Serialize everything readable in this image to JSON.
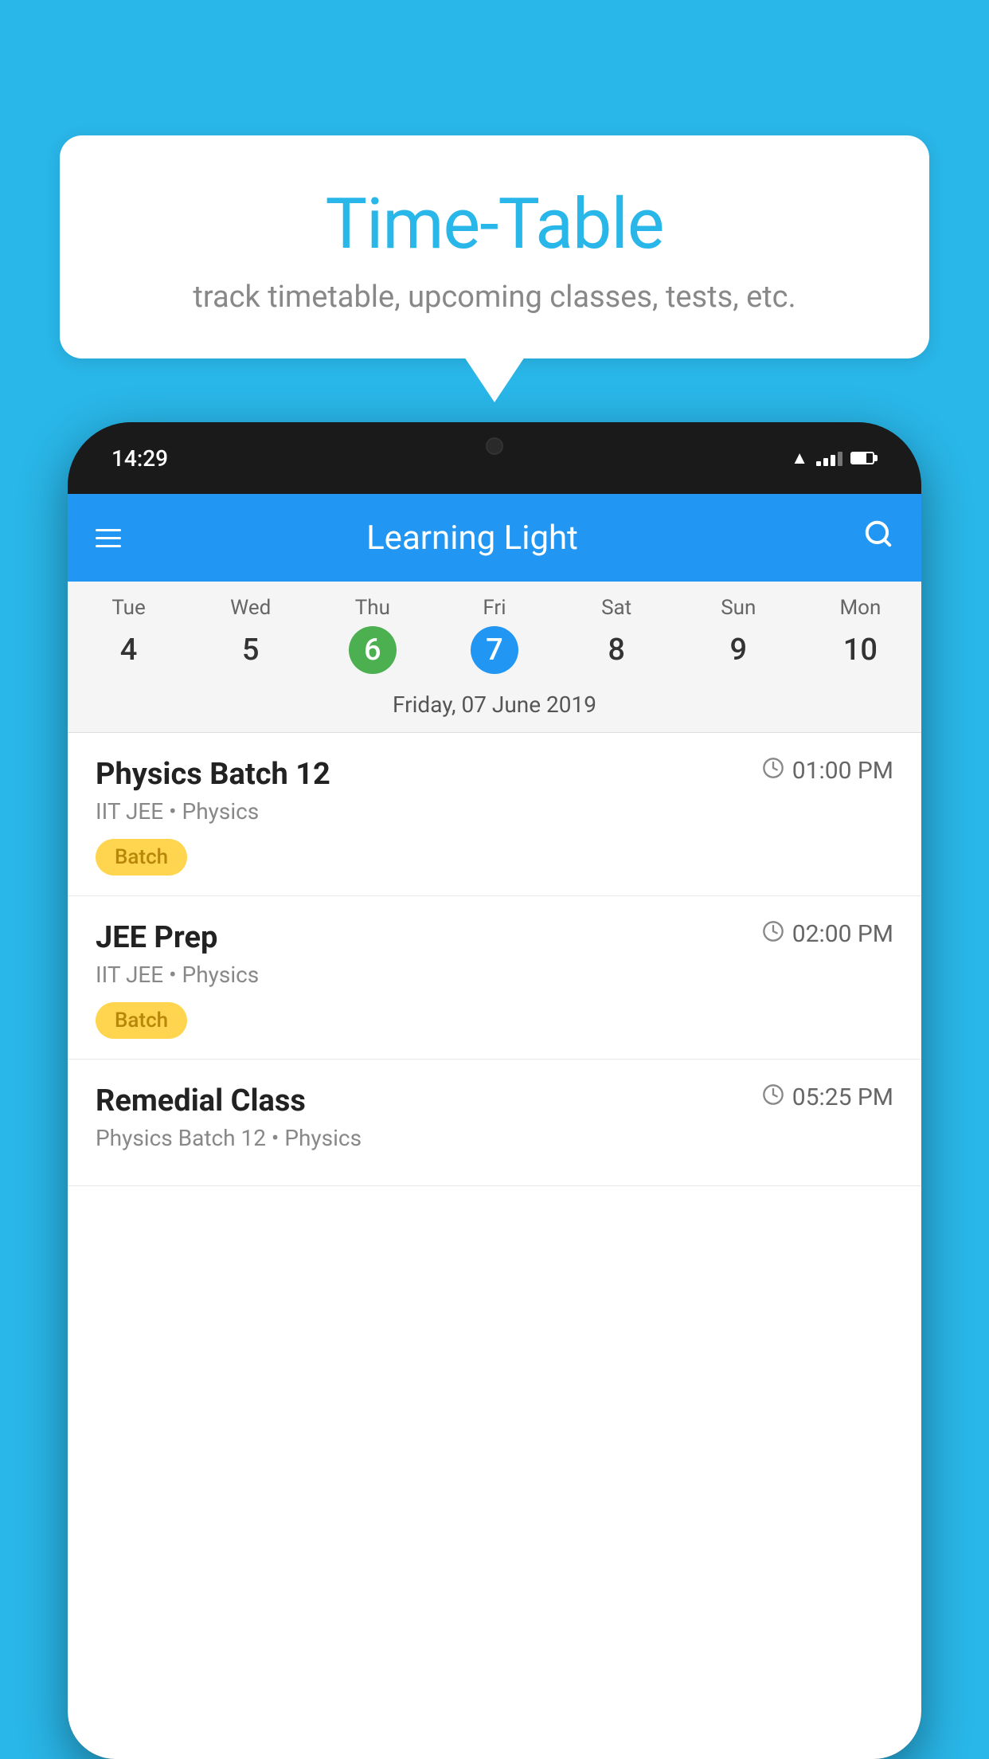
{
  "background": {
    "color": "#29b6e8"
  },
  "bubble": {
    "title": "Time-Table",
    "subtitle": "track timetable, upcoming classes, tests, etc."
  },
  "phone": {
    "status_bar": {
      "time": "14:29"
    },
    "app_header": {
      "title": "Learning Light"
    },
    "calendar": {
      "selected_date_label": "Friday, 07 June 2019",
      "days": [
        {
          "name": "Tue",
          "number": "4",
          "state": "normal"
        },
        {
          "name": "Wed",
          "number": "5",
          "state": "normal"
        },
        {
          "name": "Thu",
          "number": "6",
          "state": "today"
        },
        {
          "name": "Fri",
          "number": "7",
          "state": "selected"
        },
        {
          "name": "Sat",
          "number": "8",
          "state": "normal"
        },
        {
          "name": "Sun",
          "number": "9",
          "state": "normal"
        },
        {
          "name": "Mon",
          "number": "10",
          "state": "normal"
        }
      ]
    },
    "schedule": {
      "items": [
        {
          "title": "Physics Batch 12",
          "time": "01:00 PM",
          "subtitle": "IIT JEE • Physics",
          "badge": "Batch"
        },
        {
          "title": "JEE Prep",
          "time": "02:00 PM",
          "subtitle": "IIT JEE • Physics",
          "badge": "Batch"
        },
        {
          "title": "Remedial Class",
          "time": "05:25 PM",
          "subtitle": "Physics Batch 12 • Physics",
          "badge": null
        }
      ]
    }
  }
}
